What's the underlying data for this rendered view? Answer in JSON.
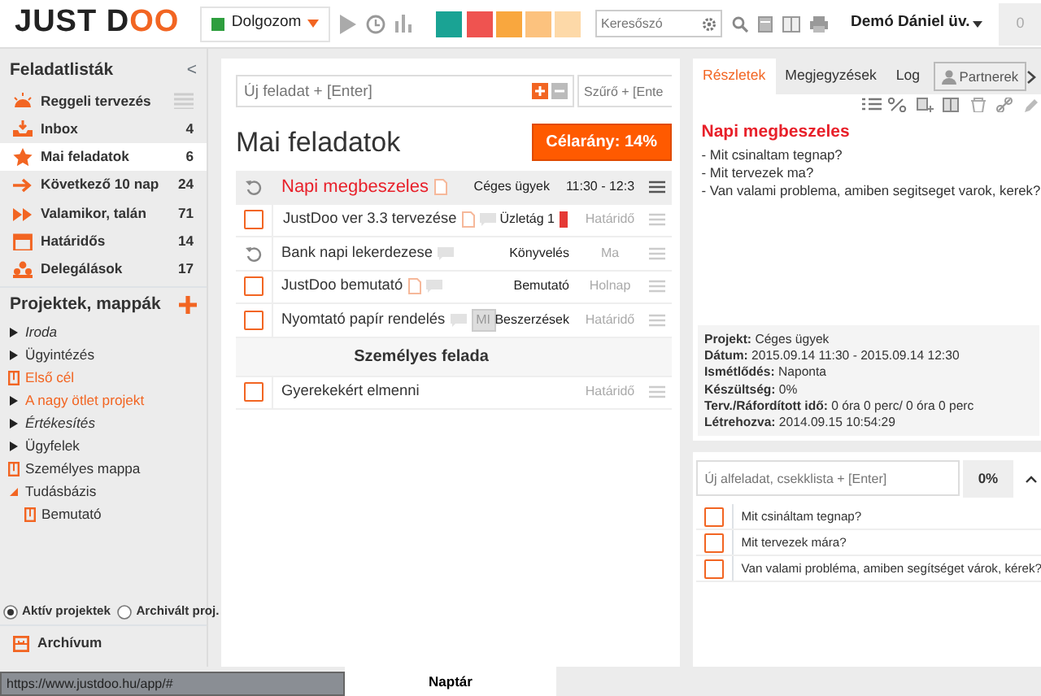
{
  "topbar": {
    "logo": {
      "main": "JUST D",
      "accent": "OO"
    },
    "status": {
      "label": "Dolgozom",
      "color": "#2e9e3e"
    },
    "color_filters": [
      {
        "color": "#1aa394"
      },
      {
        "color": "#ef5350"
      },
      {
        "color": "#f9a73e"
      },
      {
        "color": "#fcc27e"
      },
      {
        "color": "#fdd9a8"
      }
    ],
    "search": {
      "placeholder": "Keresőszó"
    },
    "user": "Demó Dániel üv.",
    "notifications": "0"
  },
  "sidebar": {
    "title": "Feladatlisták",
    "collapse": "<",
    "lists": [
      {
        "label": "Reggeli tervezés",
        "kind": "morning",
        "selected": false
      },
      {
        "label": "Inbox",
        "count": "4",
        "kind": "inbox",
        "selected": false
      },
      {
        "label": "Mai feladatok",
        "count": "6",
        "kind": "today",
        "selected": true
      },
      {
        "label": "Következő 10 nap",
        "count": "24",
        "kind": "next",
        "selected": false
      },
      {
        "label": "Valamikor, talán",
        "count": "71",
        "kind": "someday",
        "selected": false
      },
      {
        "label": "Határidős",
        "count": "14",
        "kind": "deadline",
        "selected": false
      },
      {
        "label": "Delegálások",
        "count": "17",
        "kind": "delegated",
        "selected": false
      }
    ],
    "projects_title": "Projektek, mappák",
    "projects": [
      {
        "label": "Iroda",
        "kind": "project",
        "expanded": false,
        "italic": true,
        "highlighted": false
      },
      {
        "label": "Ügyintézés",
        "kind": "project",
        "expanded": false,
        "italic": false,
        "highlighted": false
      },
      {
        "label": "Első cél",
        "kind": "folder",
        "italic": false,
        "highlighted": true
      },
      {
        "label": "A nagy ötlet projekt",
        "kind": "project",
        "expanded": false,
        "italic": false,
        "highlighted": true
      },
      {
        "label": "Értékesítés",
        "kind": "project",
        "expanded": false,
        "italic": true,
        "highlighted": false
      },
      {
        "label": "Ügyfelek",
        "kind": "project",
        "expanded": false,
        "italic": false,
        "highlighted": false
      },
      {
        "label": "Személyes mappa",
        "kind": "folder",
        "italic": false,
        "highlighted": false
      },
      {
        "label": "Tudásbázis",
        "kind": "project",
        "expanded": true,
        "italic": false,
        "highlighted": false,
        "children": [
          {
            "label": "Bemutató",
            "kind": "folder",
            "italic": false,
            "highlighted": false
          }
        ]
      }
    ],
    "project_filter": [
      {
        "label": "Aktív projektek",
        "selected": true
      },
      {
        "label": "Archivált proj.",
        "selected": false
      }
    ],
    "archive": "Archívum"
  },
  "main": {
    "new_task": {
      "placeholder": "Új feladat + [Enter]"
    },
    "filter": {
      "placeholder": "Szűrő + [Ente"
    },
    "title": "Mai feladatok",
    "goal": "Célarány: 14%",
    "tasks": [
      {
        "kind": "recurring",
        "title": "Napi megbeszeles",
        "selected": true,
        "note": true,
        "comment": false,
        "project": "Céges ügyek",
        "due": "11:30 - 12:3"
      },
      {
        "kind": "task",
        "title": "JustDoo ver 3.3 tervezése",
        "selected": false,
        "checked": false,
        "priority": true,
        "note": true,
        "comment": true,
        "project": "Üzletág 1",
        "color": "#e53935",
        "due": "Határidő"
      },
      {
        "kind": "recurring",
        "title": "Bank napi lekerdezese",
        "selected": false,
        "note": false,
        "comment": true,
        "project": "Könyvelés",
        "due": "Ma"
      },
      {
        "kind": "task",
        "title": "JustDoo bemutató",
        "selected": false,
        "checked": false,
        "priority": false,
        "note": true,
        "comment": true,
        "project": "Bemutató",
        "due": "Holnap"
      },
      {
        "kind": "task",
        "title": "Nyomtató papír rendelés",
        "selected": false,
        "checked": false,
        "priority": false,
        "note": false,
        "comment": true,
        "tag": "MI",
        "project": "Beszerzések",
        "due": "Határidő"
      },
      {
        "kind": "section",
        "title": "Személyes felada"
      },
      {
        "kind": "task",
        "title": "Gyerekekért elmenni",
        "selected": false,
        "checked": false,
        "priority": false,
        "note": false,
        "comment": false,
        "due": "Határidő"
      }
    ]
  },
  "details": {
    "tabs": [
      {
        "label": "Részletek",
        "selected": true
      },
      {
        "label": "Megjegyzések",
        "selected": false
      },
      {
        "label": "Log",
        "selected": false
      }
    ],
    "partners": "Partnerek",
    "title": "Napi megbeszeles",
    "description": [
      "- Mit csinaltam tegnap?",
      "- Mit tervezek ma?",
      "- Van valami problema, amiben segitseget varok, kerek?"
    ],
    "info": [
      "**Projekt:** Céges ügyek",
      "**Dátum:** 2015.09.14 11:30 - 2015.09.14 12:30",
      "**Ismétlődés:** Naponta",
      "**Készültség:** 0%",
      "**Terv./Ráfordított idő:** 0 óra 0 perc/ 0 óra 0 perc",
      "**Létrehozva:** 2014.09.15 10:54:29"
    ],
    "subtask": {
      "placeholder": "Új alfeladat, csekklista + [Enter]",
      "progress": "0%"
    },
    "checklist": [
      {
        "label": "Mit csináltam tegnap?",
        "checked": false
      },
      {
        "label": "Mit tervezek mára?",
        "checked": false
      },
      {
        "label": "Van valami probléma, amiben segítséget várok, kérek?",
        "checked": false
      }
    ]
  },
  "bottom": {
    "calendar": "Naptár",
    "status_url": "https://www.justdoo.hu/app/#"
  }
}
